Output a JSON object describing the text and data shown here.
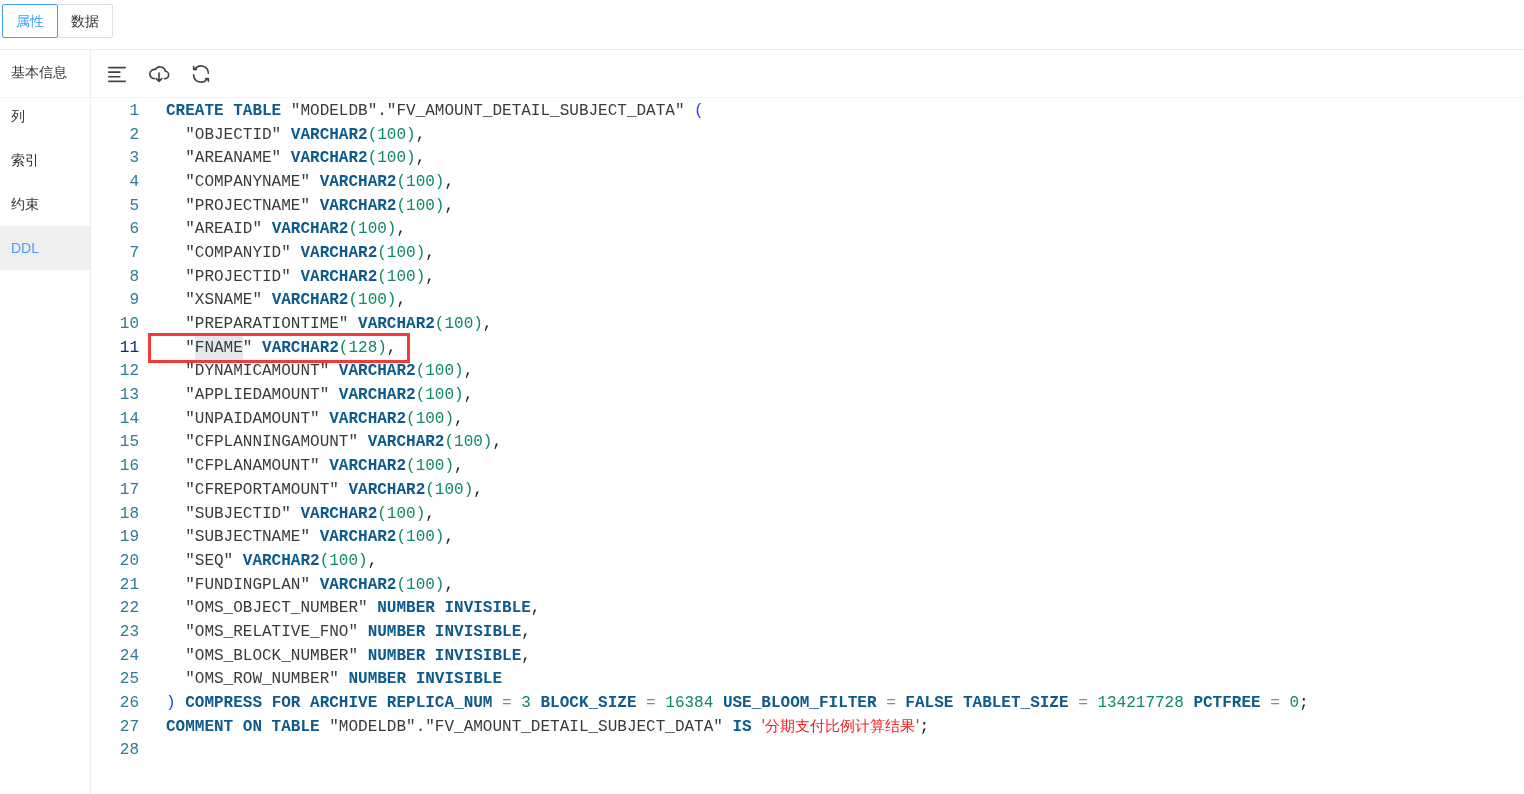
{
  "tabs": [
    {
      "label": "属性",
      "selected": true
    },
    {
      "label": "数据",
      "selected": false
    }
  ],
  "sidebar": {
    "items": [
      {
        "label": "基本信息",
        "selected": false
      },
      {
        "label": "列",
        "selected": false
      },
      {
        "label": "索引",
        "selected": false
      },
      {
        "label": "约束",
        "selected": false
      },
      {
        "label": "DDL",
        "selected": true
      }
    ]
  },
  "toolbar": [
    {
      "kind": "format"
    },
    {
      "kind": "download"
    },
    {
      "kind": "refresh"
    }
  ],
  "editor": {
    "lines": [
      {
        "number": "1",
        "active": false,
        "annotated": false,
        "tokens": [
          {
            "kind": "kw",
            "t": "CREATE TABLE "
          },
          {
            "kind": "str",
            "t": "\"MODELDB\".\"FV_AMOUNT_DETAIL_SUBJECT_DATA\" "
          },
          {
            "kind": "bracket",
            "t": "("
          }
        ]
      },
      {
        "number": "2",
        "active": false,
        "annotated": false,
        "tokens": [
          {
            "kind": "str",
            "t": "  \"OBJECTID\" "
          },
          {
            "kind": "kw",
            "t": "VARCHAR2"
          },
          {
            "kind": "num",
            "t": "(100)"
          },
          {
            "kind": "punct",
            "t": ","
          }
        ]
      },
      {
        "number": "3",
        "active": false,
        "annotated": false,
        "tokens": [
          {
            "kind": "str",
            "t": "  \"AREANAME\" "
          },
          {
            "kind": "kw",
            "t": "VARCHAR2"
          },
          {
            "kind": "num",
            "t": "(100)"
          },
          {
            "kind": "punct",
            "t": ","
          }
        ]
      },
      {
        "number": "4",
        "active": false,
        "annotated": false,
        "tokens": [
          {
            "kind": "str",
            "t": "  \"COMPANYNAME\" "
          },
          {
            "kind": "kw",
            "t": "VARCHAR2"
          },
          {
            "kind": "num",
            "t": "(100)"
          },
          {
            "kind": "punct",
            "t": ","
          }
        ]
      },
      {
        "number": "5",
        "active": false,
        "annotated": false,
        "tokens": [
          {
            "kind": "str",
            "t": "  \"PROJECTNAME\" "
          },
          {
            "kind": "kw",
            "t": "VARCHAR2"
          },
          {
            "kind": "num",
            "t": "(100)"
          },
          {
            "kind": "punct",
            "t": ","
          }
        ]
      },
      {
        "number": "6",
        "active": false,
        "annotated": false,
        "tokens": [
          {
            "kind": "str",
            "t": "  \"AREAID\" "
          },
          {
            "kind": "kw",
            "t": "VARCHAR2"
          },
          {
            "kind": "num",
            "t": "(100)"
          },
          {
            "kind": "punct",
            "t": ","
          }
        ]
      },
      {
        "number": "7",
        "active": false,
        "annotated": false,
        "tokens": [
          {
            "kind": "str",
            "t": "  \"COMPANYID\" "
          },
          {
            "kind": "kw",
            "t": "VARCHAR2"
          },
          {
            "kind": "num",
            "t": "(100)"
          },
          {
            "kind": "punct",
            "t": ","
          }
        ]
      },
      {
        "number": "8",
        "active": false,
        "annotated": false,
        "tokens": [
          {
            "kind": "str",
            "t": "  \"PROJECTID\" "
          },
          {
            "kind": "kw",
            "t": "VARCHAR2"
          },
          {
            "kind": "num",
            "t": "(100)"
          },
          {
            "kind": "punct",
            "t": ","
          }
        ]
      },
      {
        "number": "9",
        "active": false,
        "annotated": false,
        "tokens": [
          {
            "kind": "str",
            "t": "  \"XSNAME\" "
          },
          {
            "kind": "kw",
            "t": "VARCHAR2"
          },
          {
            "kind": "num",
            "t": "(100)"
          },
          {
            "kind": "punct",
            "t": ","
          }
        ]
      },
      {
        "number": "10",
        "active": false,
        "annotated": false,
        "tokens": [
          {
            "kind": "str",
            "t": "  \"PREPARATIONTIME\" "
          },
          {
            "kind": "kw",
            "t": "VARCHAR2"
          },
          {
            "kind": "num",
            "t": "(100)"
          },
          {
            "kind": "punct",
            "t": ","
          }
        ]
      },
      {
        "number": "11",
        "active": true,
        "annotated": true,
        "tokens": [
          {
            "kind": "str",
            "t": "  \""
          },
          {
            "kind": "sel",
            "t": "FNAME"
          },
          {
            "kind": "str",
            "t": "\" "
          },
          {
            "kind": "kw",
            "t": "VARCHAR2"
          },
          {
            "kind": "num",
            "t": "(128)"
          },
          {
            "kind": "punct",
            "t": ","
          }
        ]
      },
      {
        "number": "12",
        "active": false,
        "annotated": false,
        "tokens": [
          {
            "kind": "str",
            "t": "  \"DYNAMICAMOUNT\" "
          },
          {
            "kind": "kw",
            "t": "VARCHAR2"
          },
          {
            "kind": "num",
            "t": "(100)"
          },
          {
            "kind": "punct",
            "t": ","
          }
        ]
      },
      {
        "number": "13",
        "active": false,
        "annotated": false,
        "tokens": [
          {
            "kind": "str",
            "t": "  \"APPLIEDAMOUNT\" "
          },
          {
            "kind": "kw",
            "t": "VARCHAR2"
          },
          {
            "kind": "num",
            "t": "(100)"
          },
          {
            "kind": "punct",
            "t": ","
          }
        ]
      },
      {
        "number": "14",
        "active": false,
        "annotated": false,
        "tokens": [
          {
            "kind": "str",
            "t": "  \"UNPAIDAMOUNT\" "
          },
          {
            "kind": "kw",
            "t": "VARCHAR2"
          },
          {
            "kind": "num",
            "t": "(100)"
          },
          {
            "kind": "punct",
            "t": ","
          }
        ]
      },
      {
        "number": "15",
        "active": false,
        "annotated": false,
        "tokens": [
          {
            "kind": "str",
            "t": "  \"CFPLANNINGAMOUNT\" "
          },
          {
            "kind": "kw",
            "t": "VARCHAR2"
          },
          {
            "kind": "num",
            "t": "(100)"
          },
          {
            "kind": "punct",
            "t": ","
          }
        ]
      },
      {
        "number": "16",
        "active": false,
        "annotated": false,
        "tokens": [
          {
            "kind": "str",
            "t": "  \"CFPLANAMOUNT\" "
          },
          {
            "kind": "kw",
            "t": "VARCHAR2"
          },
          {
            "kind": "num",
            "t": "(100)"
          },
          {
            "kind": "punct",
            "t": ","
          }
        ]
      },
      {
        "number": "17",
        "active": false,
        "annotated": false,
        "tokens": [
          {
            "kind": "str",
            "t": "  \"CFREPORTAMOUNT\" "
          },
          {
            "kind": "kw",
            "t": "VARCHAR2"
          },
          {
            "kind": "num",
            "t": "(100)"
          },
          {
            "kind": "punct",
            "t": ","
          }
        ]
      },
      {
        "number": "18",
        "active": false,
        "annotated": false,
        "tokens": [
          {
            "kind": "str",
            "t": "  \"SUBJECTID\" "
          },
          {
            "kind": "kw",
            "t": "VARCHAR2"
          },
          {
            "kind": "num",
            "t": "(100)"
          },
          {
            "kind": "punct",
            "t": ","
          }
        ]
      },
      {
        "number": "19",
        "active": false,
        "annotated": false,
        "tokens": [
          {
            "kind": "str",
            "t": "  \"SUBJECTNAME\" "
          },
          {
            "kind": "kw",
            "t": "VARCHAR2"
          },
          {
            "kind": "num",
            "t": "(100)"
          },
          {
            "kind": "punct",
            "t": ","
          }
        ]
      },
      {
        "number": "20",
        "active": false,
        "annotated": false,
        "tokens": [
          {
            "kind": "str",
            "t": "  \"SEQ\" "
          },
          {
            "kind": "kw",
            "t": "VARCHAR2"
          },
          {
            "kind": "num",
            "t": "(100)"
          },
          {
            "kind": "punct",
            "t": ","
          }
        ]
      },
      {
        "number": "21",
        "active": false,
        "annotated": false,
        "tokens": [
          {
            "kind": "str",
            "t": "  \"FUNDINGPLAN\" "
          },
          {
            "kind": "kw",
            "t": "VARCHAR2"
          },
          {
            "kind": "num",
            "t": "(100)"
          },
          {
            "kind": "punct",
            "t": ","
          }
        ]
      },
      {
        "number": "22",
        "active": false,
        "annotated": false,
        "tokens": [
          {
            "kind": "str",
            "t": "  \"OMS_OBJECT_NUMBER\" "
          },
          {
            "kind": "kw",
            "t": "NUMBER INVISIBLE"
          },
          {
            "kind": "punct",
            "t": ","
          }
        ]
      },
      {
        "number": "23",
        "active": false,
        "annotated": false,
        "tokens": [
          {
            "kind": "str",
            "t": "  \"OMS_RELATIVE_FNO\" "
          },
          {
            "kind": "kw",
            "t": "NUMBER INVISIBLE"
          },
          {
            "kind": "punct",
            "t": ","
          }
        ]
      },
      {
        "number": "24",
        "active": false,
        "annotated": false,
        "tokens": [
          {
            "kind": "str",
            "t": "  \"OMS_BLOCK_NUMBER\" "
          },
          {
            "kind": "kw",
            "t": "NUMBER INVISIBLE"
          },
          {
            "kind": "punct",
            "t": ","
          }
        ]
      },
      {
        "number": "25",
        "active": false,
        "annotated": false,
        "tokens": [
          {
            "kind": "str",
            "t": "  \"OMS_ROW_NUMBER\" "
          },
          {
            "kind": "kw",
            "t": "NUMBER INVISIBLE"
          }
        ]
      },
      {
        "number": "26",
        "active": false,
        "annotated": false,
        "tokens": [
          {
            "kind": "bracket",
            "t": ")"
          },
          {
            "kind": "kw",
            "t": " COMPRESS FOR ARCHIVE REPLICA_NUM "
          },
          {
            "kind": "op",
            "t": "= "
          },
          {
            "kind": "num",
            "t": "3"
          },
          {
            "kind": "kw",
            "t": " BLOCK_SIZE "
          },
          {
            "kind": "op",
            "t": "= "
          },
          {
            "kind": "num",
            "t": "16384"
          },
          {
            "kind": "kw",
            "t": " USE_BLOOM_FILTER "
          },
          {
            "kind": "op",
            "t": "= "
          },
          {
            "kind": "kw",
            "t": "FALSE TABLET_SIZE "
          },
          {
            "kind": "op",
            "t": "= "
          },
          {
            "kind": "num",
            "t": "134217728"
          },
          {
            "kind": "kw",
            "t": " PCTFREE "
          },
          {
            "kind": "op",
            "t": "= "
          },
          {
            "kind": "num",
            "t": "0"
          },
          {
            "kind": "punct",
            "t": ";"
          }
        ]
      },
      {
        "number": "27",
        "active": false,
        "annotated": false,
        "tokens": [
          {
            "kind": "kw",
            "t": "COMMENT ON TABLE "
          },
          {
            "kind": "str",
            "t": "\"MODELDB\".\"FV_AMOUNT_DETAIL_SUBJECT_DATA\" "
          },
          {
            "kind": "kw",
            "t": "IS "
          },
          {
            "kind": "cn",
            "t": "'分期支付比例计算结果'"
          },
          {
            "kind": "punct",
            "t": ";"
          }
        ]
      },
      {
        "number": "28",
        "active": false,
        "annotated": false
      }
    ]
  }
}
